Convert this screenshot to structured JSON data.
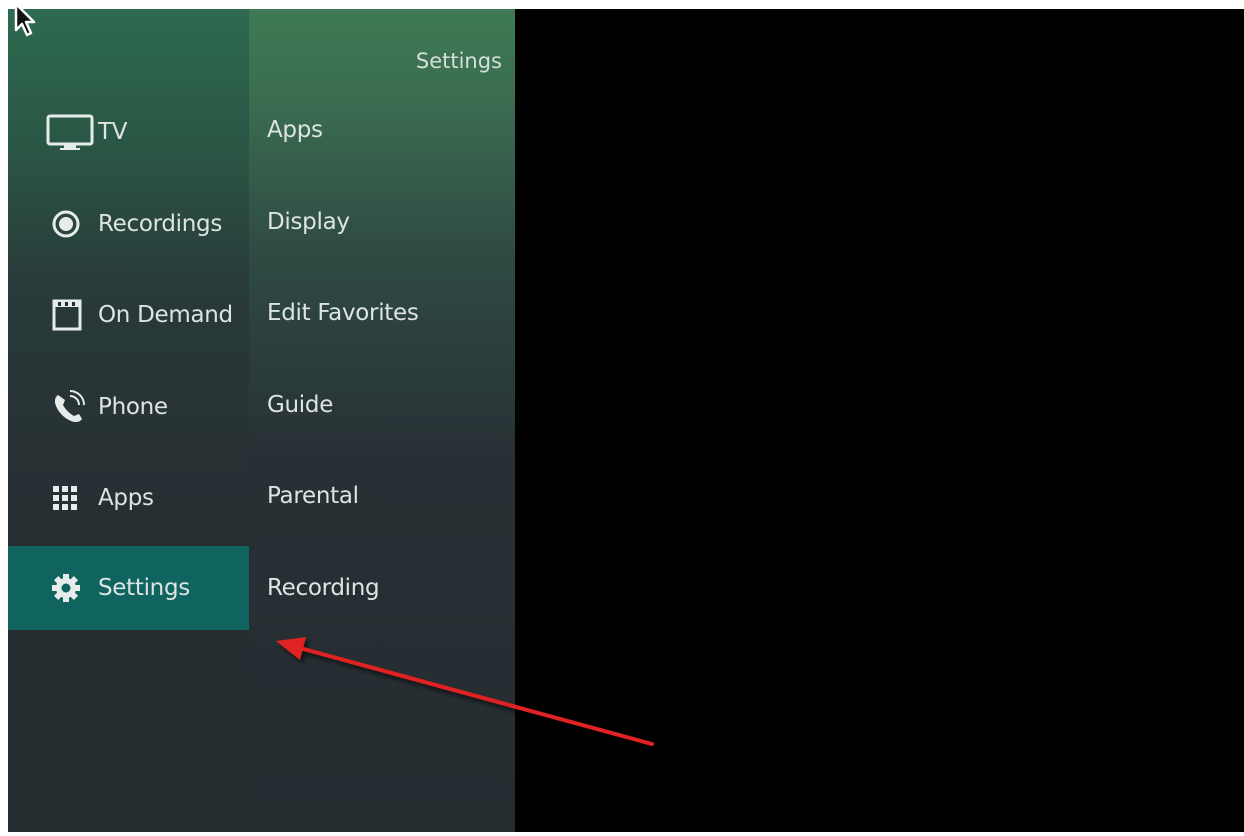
{
  "main_menu": {
    "items": [
      {
        "label": "TV",
        "icon": "tv-icon"
      },
      {
        "label": "Recordings",
        "icon": "record-icon"
      },
      {
        "label": "On Demand",
        "icon": "film-icon"
      },
      {
        "label": "Phone",
        "icon": "phone-icon"
      },
      {
        "label": "Apps",
        "icon": "apps-grid-icon"
      },
      {
        "label": "Settings",
        "icon": "gear-icon",
        "selected": true
      }
    ]
  },
  "settings_menu": {
    "title": "Settings",
    "items": [
      {
        "label": "Apps"
      },
      {
        "label": "Display"
      },
      {
        "label": "Edit Favorites"
      },
      {
        "label": "Guide"
      },
      {
        "label": "Parental"
      },
      {
        "label": "Recording"
      }
    ]
  },
  "colors": {
    "selected_bg": "#0f6460",
    "annotation_arrow": "#e02020",
    "background": "#000000"
  }
}
